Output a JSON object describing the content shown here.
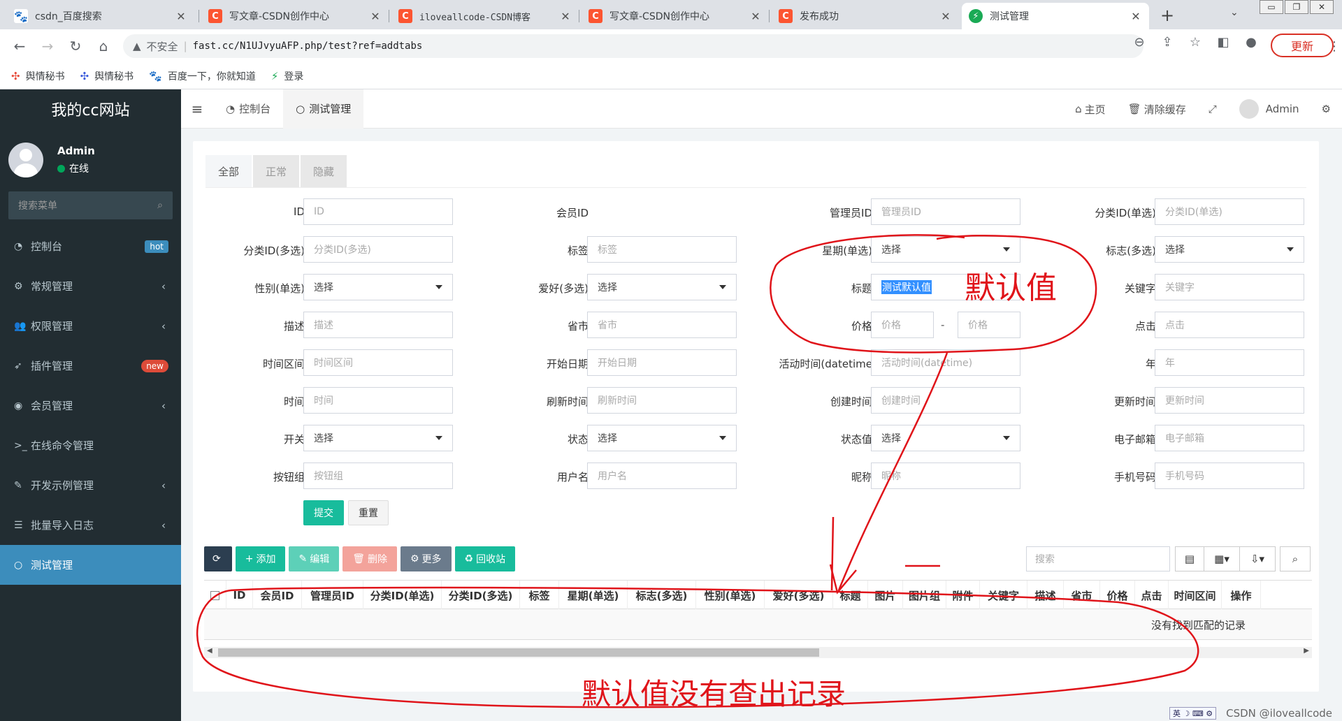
{
  "browser": {
    "tabs": [
      {
        "title": "csdn_百度搜索",
        "icon": "baidu-paw-icon"
      },
      {
        "title": "写文章-CSDN创作中心",
        "icon": "csdn-icon"
      },
      {
        "title": "iloveallcode-CSDN博客",
        "icon": "csdn-icon"
      },
      {
        "title": "写文章-CSDN创作中心",
        "icon": "csdn-icon"
      },
      {
        "title": "发布成功",
        "icon": "csdn-icon"
      },
      {
        "title": "测试管理",
        "icon": "fastadmin-icon"
      }
    ],
    "security": "不安全",
    "url": "fast.cc/N1UJvyuAFP.php/test?ref=addtabs",
    "update_label": "更新",
    "bookmarks": [
      "舆情秘书",
      "舆情秘书",
      "百度一下，你就知道",
      "登录"
    ]
  },
  "sidebar": {
    "site_name": "我的cc网站",
    "user": "Admin",
    "status": "在线",
    "search_placeholder": "搜索菜单",
    "items": [
      {
        "label": "控制台",
        "icon": "dashboard-icon",
        "badge": "hot",
        "badge_color": "#3c8dbc"
      },
      {
        "label": "常规管理",
        "icon": "cogs-icon",
        "arrow": "‹"
      },
      {
        "label": "权限管理",
        "icon": "group-icon",
        "arrow": "‹"
      },
      {
        "label": "插件管理",
        "icon": "rocket-icon",
        "badge": "new",
        "badge_color": "#dd4b39"
      },
      {
        "label": "会员管理",
        "icon": "user-circle-icon",
        "arrow": "‹"
      },
      {
        "label": "在线命令管理",
        "icon": "terminal-icon"
      },
      {
        "label": "开发示例管理",
        "icon": "magic-icon",
        "arrow": "‹"
      },
      {
        "label": "批量导入日志",
        "icon": "list-icon",
        "arrow": "‹"
      },
      {
        "label": "测试管理",
        "icon": "circle-o-icon",
        "active": true
      }
    ]
  },
  "header": {
    "tabs": [
      "控制台",
      "测试管理"
    ],
    "home": "主页",
    "clear_cache": "清除缓存",
    "admin": "Admin"
  },
  "filter_tabs": [
    "全部",
    "正常",
    "隐藏"
  ],
  "form": {
    "rows": [
      [
        {
          "label": "ID",
          "ph": "ID"
        },
        {
          "label": "会员ID",
          "ph": ""
        },
        {
          "label": "管理员ID",
          "ph": "管理员ID"
        },
        {
          "label": "分类ID(单选)",
          "ph": "分类ID(单选)"
        }
      ],
      [
        {
          "label": "分类ID(多选)",
          "ph": "分类ID(多选)"
        },
        {
          "label": "标签",
          "ph": "标签"
        },
        {
          "label": "星期(单选)",
          "ph": "选择",
          "select": true
        },
        {
          "label": "标志(多选)",
          "ph": "选择",
          "select": true
        }
      ],
      [
        {
          "label": "性别(单选)",
          "ph": "选择",
          "select": true
        },
        {
          "label": "爱好(多选)",
          "ph": "选择",
          "select": true
        },
        {
          "label": "标题",
          "ph": "测试默认值",
          "value": true
        },
        {
          "label": "关键字",
          "ph": "关键字"
        }
      ],
      [
        {
          "label": "描述",
          "ph": "描述"
        },
        {
          "label": "省市",
          "ph": "省市"
        },
        {
          "label": "价格",
          "ph": "价格",
          "range": "价格"
        },
        {
          "label": "点击",
          "ph": "点击"
        }
      ],
      [
        {
          "label": "时间区间",
          "ph": "时间区间"
        },
        {
          "label": "开始日期",
          "ph": "开始日期"
        },
        {
          "label": "活动时间(datetime",
          "ph": "活动时间(datetime)"
        },
        {
          "label": "年",
          "ph": "年"
        }
      ],
      [
        {
          "label": "时间",
          "ph": "时间"
        },
        {
          "label": "刷新时间",
          "ph": "刷新时间"
        },
        {
          "label": "创建时间",
          "ph": "创建时间"
        },
        {
          "label": "更新时间",
          "ph": "更新时间"
        }
      ],
      [
        {
          "label": "开关",
          "ph": "选择",
          "select": true
        },
        {
          "label": "状态",
          "ph": "选择",
          "select": true
        },
        {
          "label": "状态值",
          "ph": "选择",
          "select": true
        },
        {
          "label": "电子邮箱",
          "ph": "电子邮箱"
        }
      ],
      [
        {
          "label": "按钮组",
          "ph": "按钮组"
        },
        {
          "label": "用户名",
          "ph": "用户名"
        },
        {
          "label": "昵称",
          "ph": "昵称"
        },
        {
          "label": "手机号码",
          "ph": "手机号码"
        }
      ]
    ],
    "range_sep": "-",
    "submit": "提交",
    "reset": "重置"
  },
  "toolbar": {
    "add": "添加",
    "edit": "编辑",
    "delete": "删除",
    "more": "更多",
    "recycle": "回收站",
    "search_placeholder": "搜索",
    "colors": {
      "refresh": "#2c3e50",
      "add": "#18bc9c",
      "edit": "#5dd0b8",
      "delete": "#f3a39b",
      "more": "#6b7b8c",
      "recycle": "#18bc9c"
    }
  },
  "table": {
    "columns": [
      "ID",
      "会员ID",
      "管理员ID",
      "分类ID(单选)",
      "分类ID(多选)",
      "标签",
      "星期(单选)",
      "标志(多选)",
      "性别(单选)",
      "爱好(多选)",
      "标题",
      "图片",
      "图片组",
      "附件",
      "关键字",
      "描述",
      "省市",
      "价格",
      "点击",
      "时间区间",
      "操作"
    ],
    "empty_text": "没有找到匹配的记录"
  },
  "annotations": {
    "label_default": "默认值",
    "label_no_records": "默认值没有查出记录",
    "color": "#e0141a"
  },
  "watermark": "CSDN @iloveallcode",
  "ime_text": "英"
}
